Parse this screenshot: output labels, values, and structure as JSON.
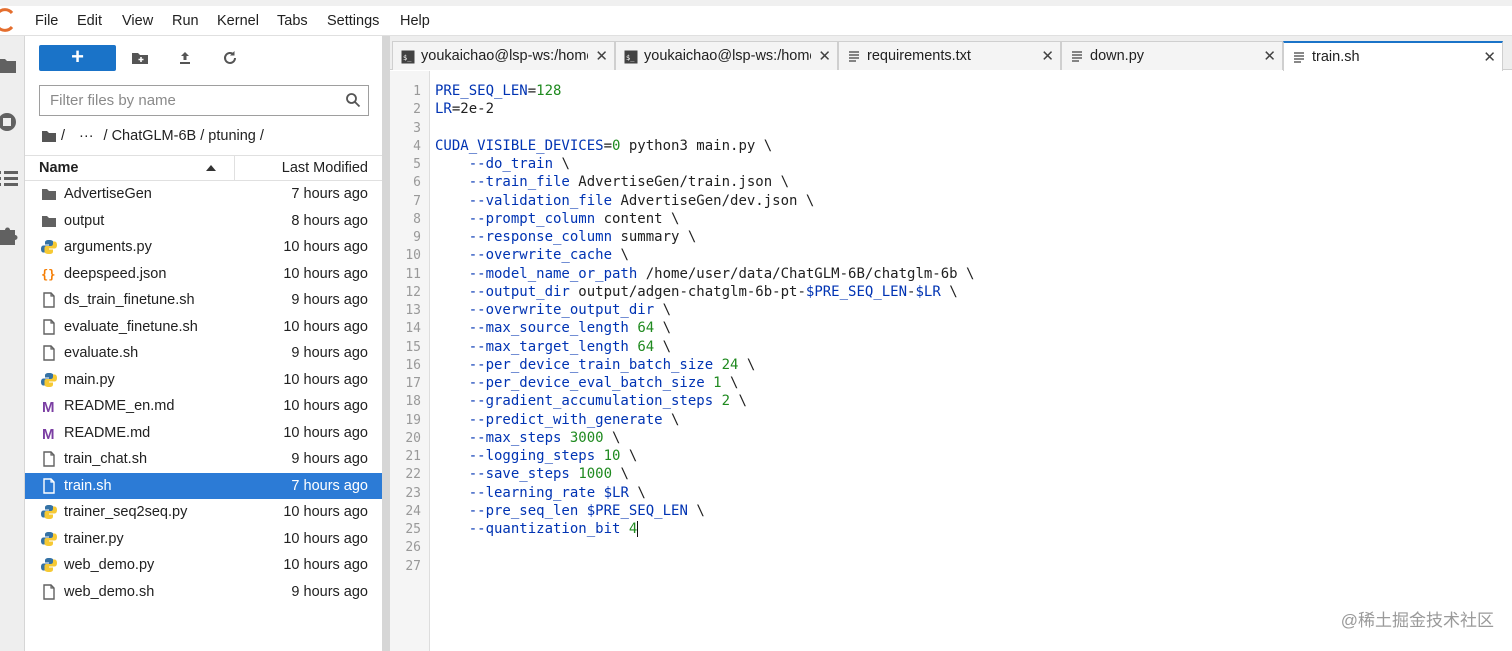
{
  "menu": [
    "File",
    "Edit",
    "View",
    "Run",
    "Kernel",
    "Tabs",
    "Settings",
    "Help"
  ],
  "filebrowser": {
    "new_label": "+",
    "filter_placeholder": "Filter files by name",
    "breadcrumb": [
      "/",
      "···",
      "/ ChatGLM-6B / ptuning /"
    ],
    "col_name": "Name",
    "col_modified": "Last Modified",
    "files": [
      {
        "name": "AdvertiseGen",
        "modified": "7 hours ago",
        "icon": "folder-icon"
      },
      {
        "name": "output",
        "modified": "8 hours ago",
        "icon": "folder-icon"
      },
      {
        "name": "arguments.py",
        "modified": "10 hours ago",
        "icon": "python-icon"
      },
      {
        "name": "deepspeed.json",
        "modified": "10 hours ago",
        "icon": "json-icon"
      },
      {
        "name": "ds_train_finetune.sh",
        "modified": "9 hours ago",
        "icon": "file-icon"
      },
      {
        "name": "evaluate_finetune.sh",
        "modified": "10 hours ago",
        "icon": "file-icon"
      },
      {
        "name": "evaluate.sh",
        "modified": "9 hours ago",
        "icon": "file-icon"
      },
      {
        "name": "main.py",
        "modified": "10 hours ago",
        "icon": "python-icon"
      },
      {
        "name": "README_en.md",
        "modified": "10 hours ago",
        "icon": "markdown-icon"
      },
      {
        "name": "README.md",
        "modified": "10 hours ago",
        "icon": "markdown-icon"
      },
      {
        "name": "train_chat.sh",
        "modified": "9 hours ago",
        "icon": "file-icon"
      },
      {
        "name": "train.sh",
        "modified": "7 hours ago",
        "icon": "file-icon",
        "selected": true
      },
      {
        "name": "trainer_seq2seq.py",
        "modified": "10 hours ago",
        "icon": "python-icon"
      },
      {
        "name": "trainer.py",
        "modified": "10 hours ago",
        "icon": "python-icon"
      },
      {
        "name": "web_demo.py",
        "modified": "10 hours ago",
        "icon": "python-icon"
      },
      {
        "name": "web_demo.sh",
        "modified": "9 hours ago",
        "icon": "file-icon"
      }
    ]
  },
  "tabs": [
    {
      "label": "youkaichao@lsp-ws:/home",
      "icon": "terminal-icon",
      "close": "✕"
    },
    {
      "label": "youkaichao@lsp-ws:/home",
      "icon": "terminal-icon",
      "close": "✕"
    },
    {
      "label": "requirements.txt",
      "icon": "text-file-icon",
      "close": "✕"
    },
    {
      "label": "down.py",
      "icon": "text-file-icon",
      "close": "✕"
    },
    {
      "label": "train.sh",
      "icon": "text-file-icon",
      "close": "✕",
      "active": true
    }
  ],
  "code_lines": [
    [
      [
        "v",
        "PRE_SEQ_LEN"
      ],
      [
        "p",
        "="
      ],
      [
        "n",
        "128"
      ]
    ],
    [
      [
        "v",
        "LR"
      ],
      [
        "p",
        "=2e-2"
      ]
    ],
    [],
    [
      [
        "v",
        "CUDA_VISIBLE_DEVICES"
      ],
      [
        "p",
        "="
      ],
      [
        "n",
        "0"
      ],
      [
        "p",
        " python3 main.py \\"
      ]
    ],
    [
      [
        "p",
        "    "
      ],
      [
        "v",
        "--do_train"
      ],
      [
        "p",
        " \\"
      ]
    ],
    [
      [
        "p",
        "    "
      ],
      [
        "v",
        "--train_file"
      ],
      [
        "p",
        " AdvertiseGen/train.json \\"
      ]
    ],
    [
      [
        "p",
        "    "
      ],
      [
        "v",
        "--validation_file"
      ],
      [
        "p",
        " AdvertiseGen/dev.json \\"
      ]
    ],
    [
      [
        "p",
        "    "
      ],
      [
        "v",
        "--prompt_column"
      ],
      [
        "p",
        " content \\"
      ]
    ],
    [
      [
        "p",
        "    "
      ],
      [
        "v",
        "--response_column"
      ],
      [
        "p",
        " summary \\"
      ]
    ],
    [
      [
        "p",
        "    "
      ],
      [
        "v",
        "--overwrite_cache"
      ],
      [
        "p",
        " \\"
      ]
    ],
    [
      [
        "p",
        "    "
      ],
      [
        "v",
        "--model_name_or_path"
      ],
      [
        "p",
        " /home/user/data/ChatGLM-6B/chatglm-6b \\"
      ]
    ],
    [
      [
        "p",
        "    "
      ],
      [
        "v",
        "--output_dir"
      ],
      [
        "p",
        " output/adgen-chatglm-6b-pt-"
      ],
      [
        "v",
        "$PRE_SEQ_LEN"
      ],
      [
        "p",
        "-"
      ],
      [
        "v",
        "$LR"
      ],
      [
        "p",
        " \\"
      ]
    ],
    [
      [
        "p",
        "    "
      ],
      [
        "v",
        "--overwrite_output_dir"
      ],
      [
        "p",
        " \\"
      ]
    ],
    [
      [
        "p",
        "    "
      ],
      [
        "v",
        "--max_source_length"
      ],
      [
        "p",
        " "
      ],
      [
        "n",
        "64"
      ],
      [
        "p",
        " \\"
      ]
    ],
    [
      [
        "p",
        "    "
      ],
      [
        "v",
        "--max_target_length"
      ],
      [
        "p",
        " "
      ],
      [
        "n",
        "64"
      ],
      [
        "p",
        " \\"
      ]
    ],
    [
      [
        "p",
        "    "
      ],
      [
        "v",
        "--per_device_train_batch_size"
      ],
      [
        "p",
        " "
      ],
      [
        "n",
        "24"
      ],
      [
        "p",
        " \\"
      ]
    ],
    [
      [
        "p",
        "    "
      ],
      [
        "v",
        "--per_device_eval_batch_size"
      ],
      [
        "p",
        " "
      ],
      [
        "n",
        "1"
      ],
      [
        "p",
        " \\"
      ]
    ],
    [
      [
        "p",
        "    "
      ],
      [
        "v",
        "--gradient_accumulation_steps"
      ],
      [
        "p",
        " "
      ],
      [
        "n",
        "2"
      ],
      [
        "p",
        " \\"
      ]
    ],
    [
      [
        "p",
        "    "
      ],
      [
        "v",
        "--predict_with_generate"
      ],
      [
        "p",
        " \\"
      ]
    ],
    [
      [
        "p",
        "    "
      ],
      [
        "v",
        "--max_steps"
      ],
      [
        "p",
        " "
      ],
      [
        "n",
        "3000"
      ],
      [
        "p",
        " \\"
      ]
    ],
    [
      [
        "p",
        "    "
      ],
      [
        "v",
        "--logging_steps"
      ],
      [
        "p",
        " "
      ],
      [
        "n",
        "10"
      ],
      [
        "p",
        " \\"
      ]
    ],
    [
      [
        "p",
        "    "
      ],
      [
        "v",
        "--save_steps"
      ],
      [
        "p",
        " "
      ],
      [
        "n",
        "1000"
      ],
      [
        "p",
        " \\"
      ]
    ],
    [
      [
        "p",
        "    "
      ],
      [
        "v",
        "--learning_rate"
      ],
      [
        "p",
        " "
      ],
      [
        "v",
        "$LR"
      ],
      [
        "p",
        " \\"
      ]
    ],
    [
      [
        "p",
        "    "
      ],
      [
        "v",
        "--pre_seq_len"
      ],
      [
        "p",
        " "
      ],
      [
        "v",
        "$PRE_SEQ_LEN"
      ],
      [
        "p",
        " \\"
      ]
    ],
    [
      [
        "p",
        "    "
      ],
      [
        "v",
        "--quantization_bit"
      ],
      [
        "p",
        " "
      ],
      [
        "n",
        "4"
      ]
    ],
    [],
    []
  ],
  "watermark": "@稀土掘金技术社区",
  "colors": {
    "accent": "#1a73c8",
    "selected_row": "#2c7bd6",
    "code_var": "#0033b3",
    "code_num": "#1f8a1f"
  }
}
